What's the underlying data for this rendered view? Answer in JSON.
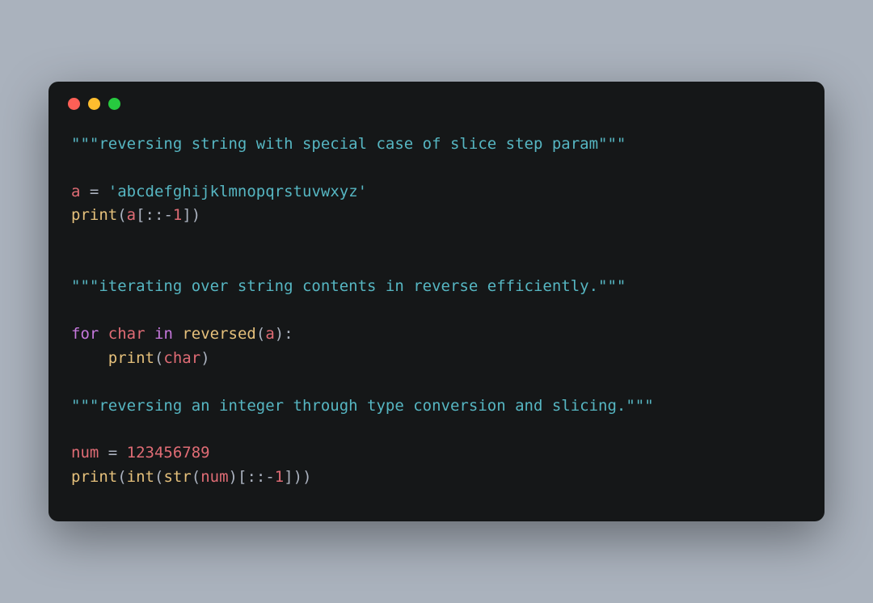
{
  "code": {
    "line1_docstring": "\"\"\"reversing string with special case of slice step param\"\"\"",
    "line3_var": "a",
    "line3_eq": " = ",
    "line3_str": "'abcdefghijklmnopqrstuvwxyz'",
    "line4_fn": "print",
    "line4_open": "(",
    "line4_var": "a",
    "line4_slice_open": "[::",
    "line4_neg": "-",
    "line4_num": "1",
    "line4_close": "])",
    "line7_docstring": "\"\"\"iterating over string contents in reverse efficiently.\"\"\"",
    "line9_for": "for",
    "line9_sp1": " ",
    "line9_char": "char",
    "line9_sp2": " ",
    "line9_in": "in",
    "line9_sp3": " ",
    "line9_rev": "reversed",
    "line9_open": "(",
    "line9_a": "a",
    "line9_close": "):",
    "line10_indent": "    ",
    "line10_fn": "print",
    "line10_open": "(",
    "line10_char": "char",
    "line10_close": ")",
    "line12_docstring": "\"\"\"reversing an integer through type conversion and slicing.\"\"\"",
    "line14_var": "num",
    "line14_eq": " = ",
    "line14_num": "123456789",
    "line15_print": "print",
    "line15_open1": "(",
    "line15_int": "int",
    "line15_open2": "(",
    "line15_str": "str",
    "line15_open3": "(",
    "line15_numvar": "num",
    "line15_close3": ")",
    "line15_slice": "[::",
    "line15_neg": "-",
    "line15_one": "1",
    "line15_close": "]))"
  }
}
